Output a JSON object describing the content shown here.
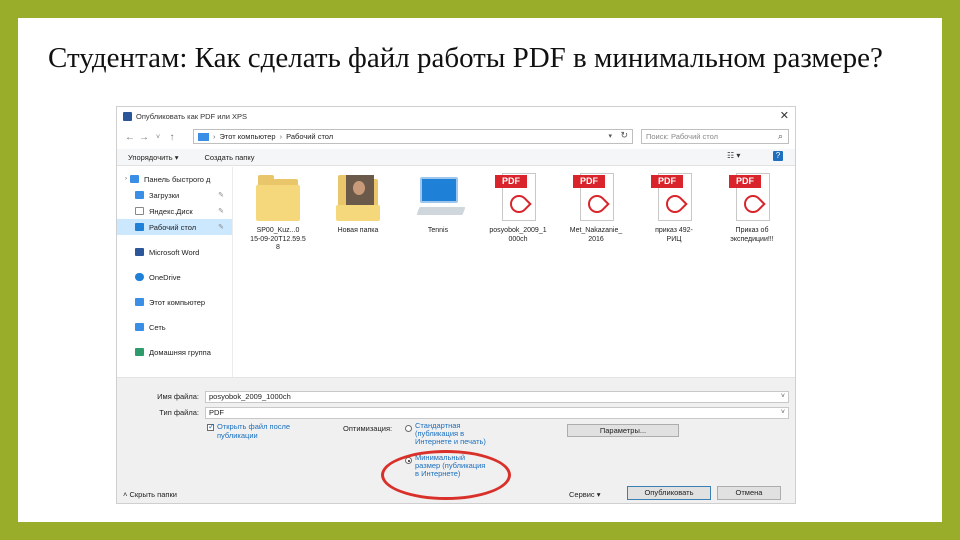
{
  "slide": {
    "title": "Студентам: Как сделать файл работы PDF в минимальном размере?"
  },
  "dialog": {
    "title": "Опубликовать как PDF или XPS",
    "address": [
      "Этот компьютер",
      "Рабочий стол"
    ],
    "search_placeholder": "Поиск: Рабочий стол",
    "toolbar": {
      "organize": "Упорядочить ▾",
      "new_folder": "Создать папку"
    },
    "nav_pane": [
      {
        "label": "Панель быстрого д",
        "icon": "star-icon",
        "pinned": false,
        "selected": false
      },
      {
        "label": "Загрузки",
        "icon": "download-icon",
        "pinned": true,
        "selected": false
      },
      {
        "label": "Яндекс.Диск",
        "icon": "cloud-icon",
        "pinned": true,
        "selected": false
      },
      {
        "label": "Рабочий стол",
        "icon": "desktop-icon",
        "pinned": true,
        "selected": true
      },
      {
        "label": "Microsoft Word",
        "icon": "word-icon",
        "pinned": false,
        "selected": false
      },
      {
        "label": "OneDrive",
        "icon": "onedrive-icon",
        "pinned": false,
        "selected": false
      },
      {
        "label": "Этот компьютер",
        "icon": "computer-icon",
        "pinned": false,
        "selected": false
      },
      {
        "label": "Сеть",
        "icon": "network-icon",
        "pinned": false,
        "selected": false
      },
      {
        "label": "Домашняя группа",
        "icon": "homegroup-icon",
        "pinned": false,
        "selected": false
      }
    ],
    "files": [
      {
        "label": "SP00_Kuz...0\n15-09-20T12.59.5\n8",
        "kind": "folder"
      },
      {
        "label": "Новая папка",
        "kind": "photo-folder"
      },
      {
        "label": "Tennis",
        "kind": "computer"
      },
      {
        "label": "posyobok_2009_1\n000ch",
        "kind": "pdf"
      },
      {
        "label": "Met_Nakazanie_\n2016",
        "kind": "pdf"
      },
      {
        "label": "приказ 492-\nРИЦ",
        "kind": "pdf"
      },
      {
        "label": "Приказ об\nэкспедиции!!!",
        "kind": "pdf"
      }
    ],
    "filename_label": "Имя файла:",
    "filename_value": "posyobok_2009_1000ch",
    "filetype_label": "Тип файла:",
    "filetype_value": "PDF",
    "open_after": {
      "line1": "Открыть файл после",
      "line2": "публикации",
      "checked": true
    },
    "optimization_label": "Оптимизация:",
    "standard": {
      "line1": "Стандартная",
      "line2": "(публикация в",
      "line3": "Интернете и печать)"
    },
    "minimal": {
      "line1": "Минимальный",
      "line2": "размер (публикация",
      "line3": "в Интернете)"
    },
    "selected_option": "minimal",
    "params_button": "Параметры...",
    "hide_folders": "Скрыть папки",
    "service": "Сервис ▾",
    "publish": "Опубликовать",
    "cancel": "Отмена",
    "colors": {
      "link_blue": "#1a6fc0",
      "highlight": "#d9312a",
      "slide_border": "#9aad2a"
    }
  }
}
